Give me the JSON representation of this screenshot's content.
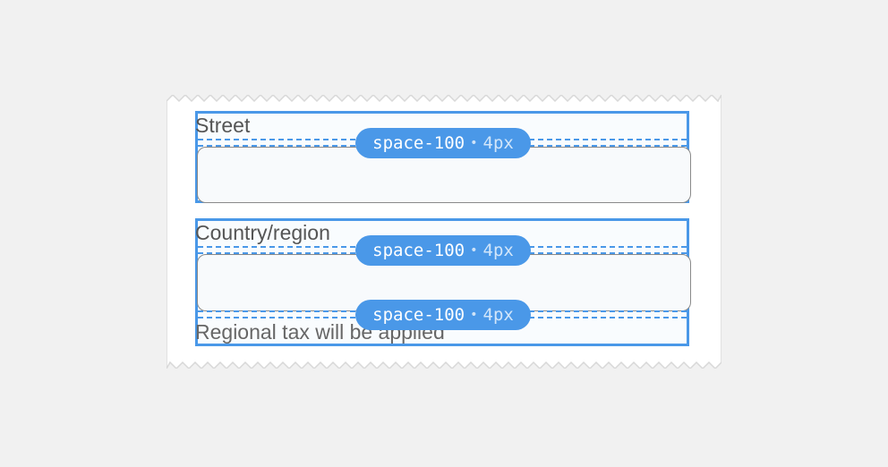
{
  "colors": {
    "page_bg": "#f1f1f1",
    "spacing_accent": "#4a98e8",
    "input_bg": "#f8fafc",
    "input_border": "#8a8a8a",
    "label_text": "#555555"
  },
  "fields": [
    {
      "label": "Street",
      "input_value": "",
      "help_text": "",
      "spacing_badges": [
        {
          "token": "space-100",
          "separator": "•",
          "value": "4px"
        }
      ]
    },
    {
      "label": "Country/region",
      "input_value": "",
      "help_text": "Regional tax will be applied",
      "spacing_badges": [
        {
          "token": "space-100",
          "separator": "•",
          "value": "4px"
        },
        {
          "token": "space-100",
          "separator": "•",
          "value": "4px"
        }
      ]
    }
  ]
}
